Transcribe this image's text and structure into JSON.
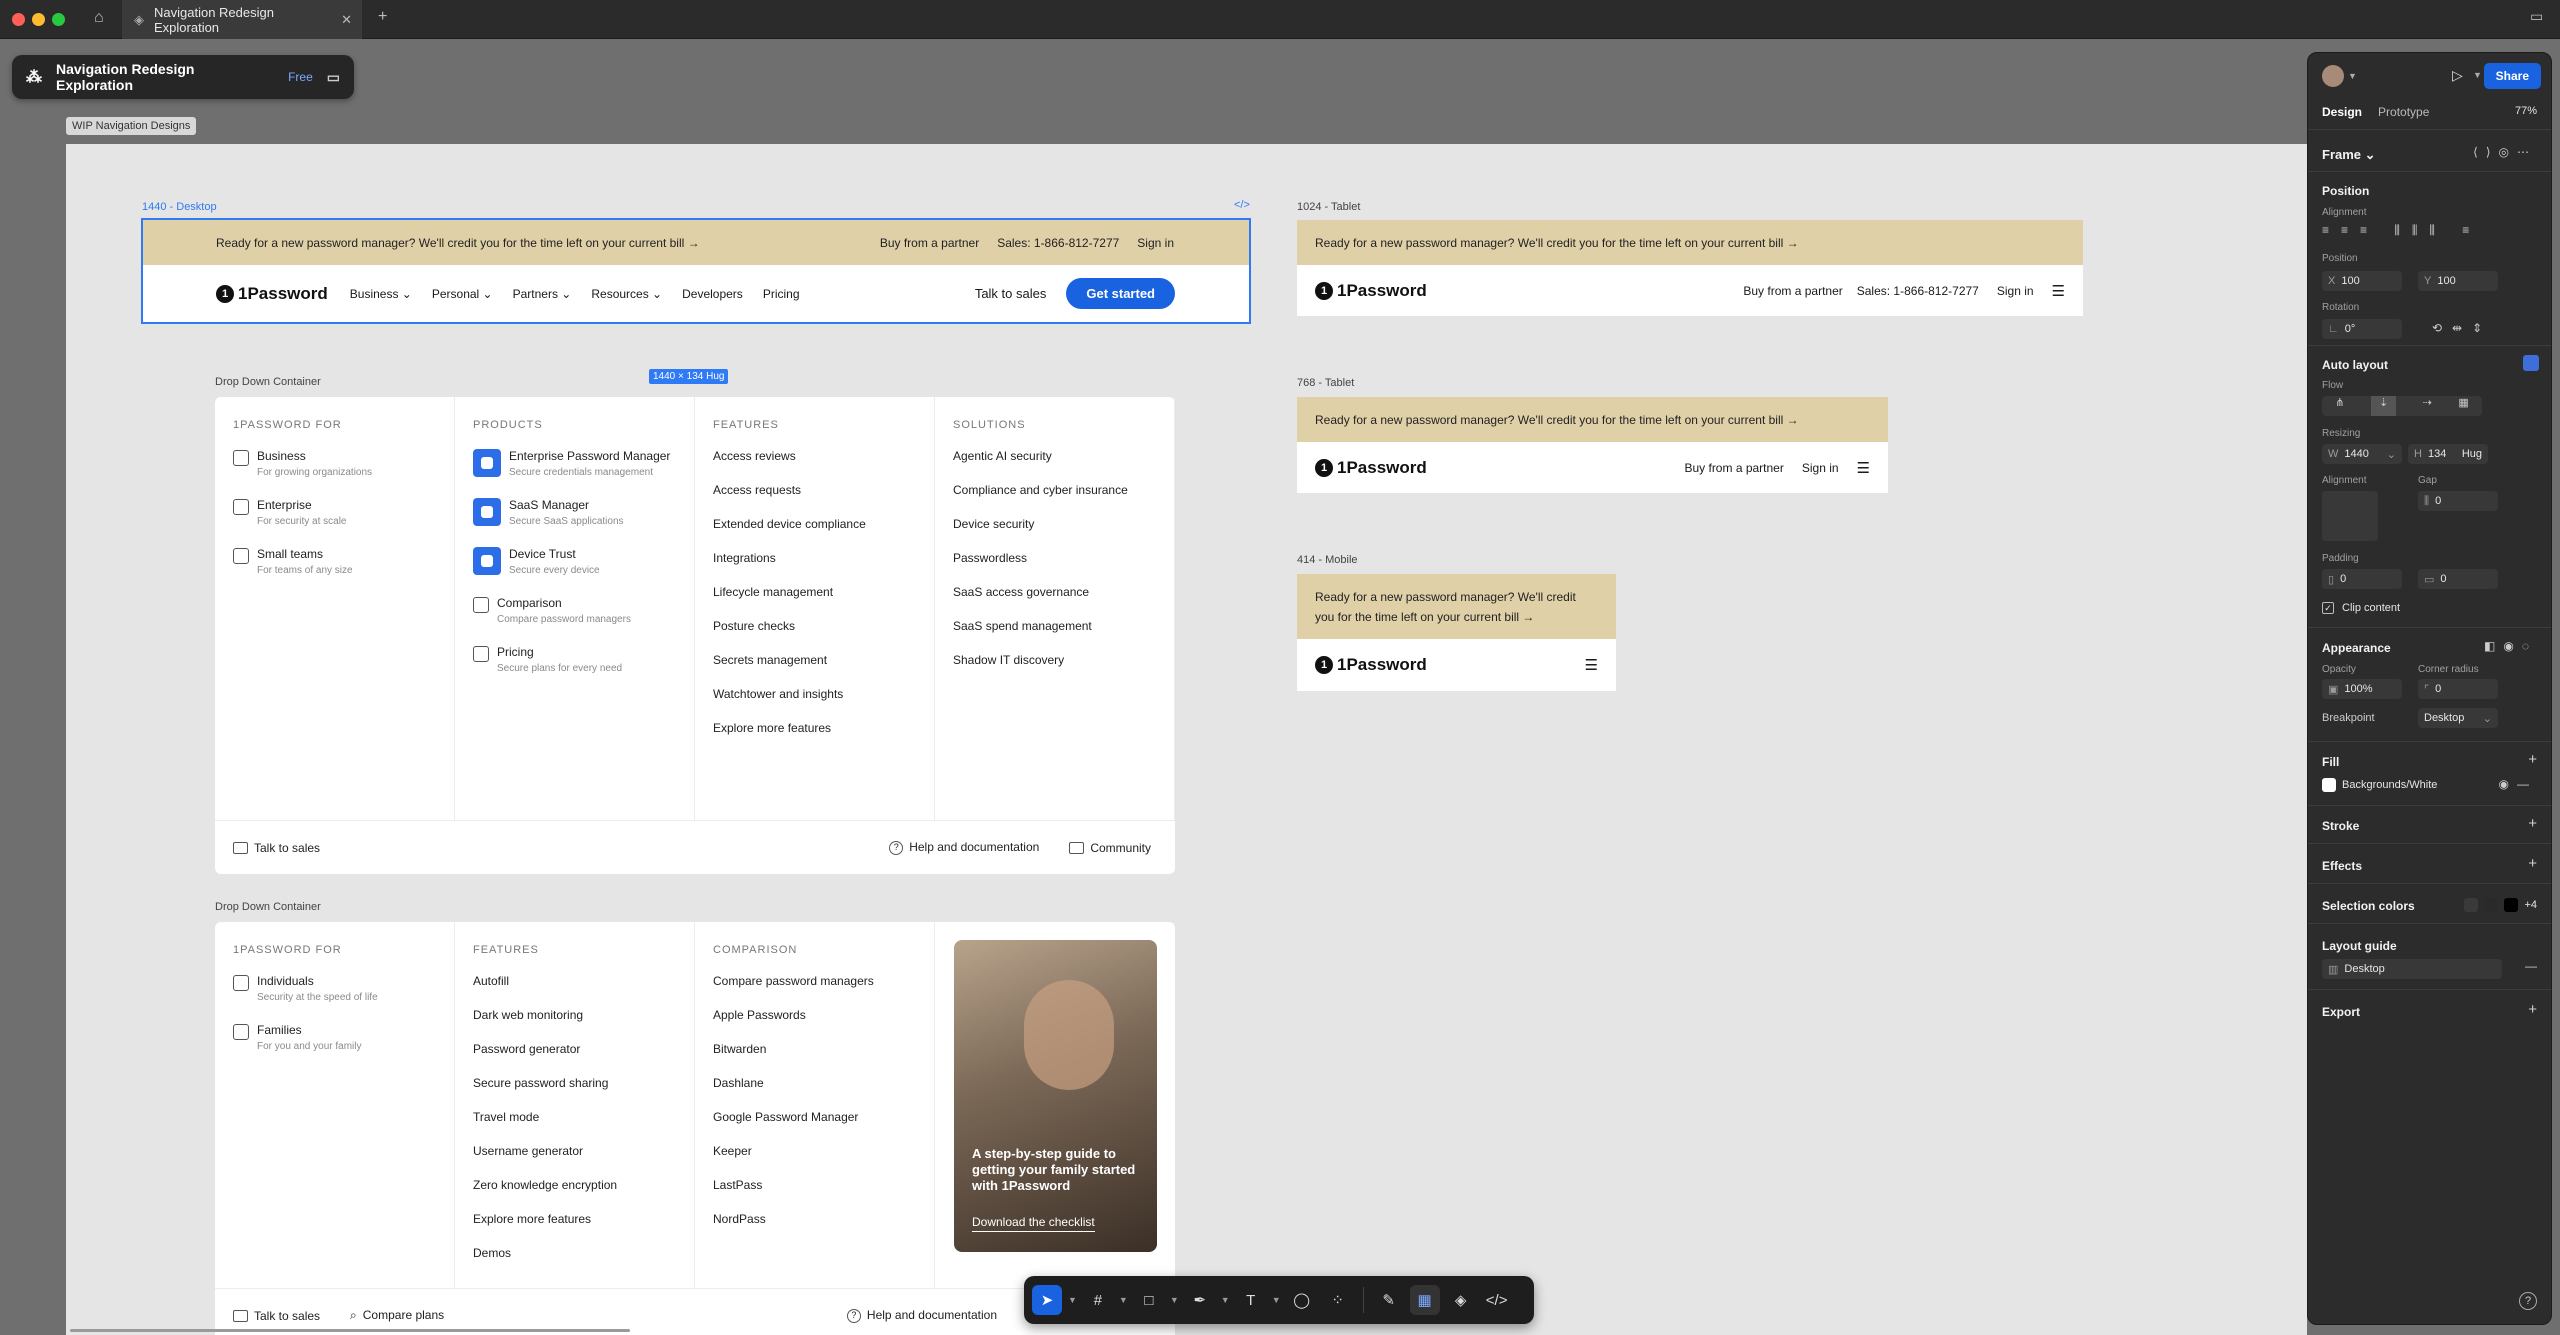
{
  "window": {
    "tab_title": "Navigation Redesign Exploration"
  },
  "file": {
    "name": "Navigation Redesign Exploration",
    "plan_badge": "Free"
  },
  "page_label": "WIP Navigation Designs",
  "frames": {
    "desktop": {
      "label": "1440 - Desktop",
      "size_badge": "1440 × 134 Hug"
    },
    "tablet1024": {
      "label": "1024 - Tablet"
    },
    "tablet768": {
      "label": "768 - Tablet"
    },
    "mobile": {
      "label": "414 - Mobile"
    }
  },
  "banner": {
    "text": "Ready for a new password manager? We'll credit you for the time left on your current bill →",
    "mobile_line1": "Ready for a new password manager? We'll credit",
    "mobile_line2": "you for the time left on your current bill →",
    "buy": "Buy from a partner",
    "sales": "Sales: 1-866-812-7277",
    "signin": "Sign in"
  },
  "nav": {
    "logo": "1Password",
    "items": [
      "Business ⌄",
      "Personal ⌄",
      "Partners ⌄",
      "Resources ⌄",
      "Developers",
      "Pricing"
    ],
    "talk": "Talk to sales",
    "cta": "Get started"
  },
  "dropdown1": {
    "label": "Drop Down Container",
    "col1": {
      "head": "1PASSWORD FOR",
      "items": [
        {
          "title": "Business",
          "sub": "For growing organizations"
        },
        {
          "title": "Enterprise",
          "sub": "For security at scale"
        },
        {
          "title": "Small teams",
          "sub": "For teams of any size"
        }
      ]
    },
    "col2": {
      "head": "PRODUCTS",
      "items": [
        {
          "title": "Enterprise Password Manager",
          "sub": "Secure credentials management"
        },
        {
          "title": "SaaS Manager",
          "sub": "Secure SaaS applications"
        },
        {
          "title": "Device Trust",
          "sub": "Secure every device"
        },
        {
          "title": "Comparison",
          "sub": "Compare password managers"
        },
        {
          "title": "Pricing",
          "sub": "Secure plans for every need"
        }
      ]
    },
    "col3": {
      "head": "FEATURES",
      "links": [
        "Access reviews",
        "Access requests",
        "Extended device compliance",
        "Integrations",
        "Lifecycle management",
        "Posture checks",
        "Secrets management",
        "Watchtower and insights",
        "Explore more features"
      ]
    },
    "col4": {
      "head": "SOLUTIONS",
      "links": [
        "Agentic AI security",
        "Compliance and cyber insurance",
        "Device security",
        "Passwordless",
        "SaaS access governance",
        "SaaS spend management",
        "Shadow IT discovery"
      ]
    },
    "footer": {
      "talk": "Talk to sales",
      "help": "Help and documentation",
      "community": "Community"
    }
  },
  "dropdown2": {
    "label": "Drop Down Container",
    "col1": {
      "head": "1PASSWORD FOR",
      "items": [
        {
          "title": "Individuals",
          "sub": "Security at the speed of life"
        },
        {
          "title": "Families",
          "sub": "For you and your family"
        }
      ]
    },
    "col2": {
      "head": "FEATURES",
      "links": [
        "Autofill",
        "Dark web monitoring",
        "Password generator",
        "Secure password sharing",
        "Travel mode",
        "Username generator",
        "Zero knowledge encryption",
        "Explore more features",
        "Demos"
      ]
    },
    "col3": {
      "head": "COMPARISON",
      "links": [
        "Compare password managers",
        "Apple Passwords",
        "Bitwarden",
        "Dashlane",
        "Google Password Manager",
        "Keeper",
        "LastPass",
        "NordPass"
      ]
    },
    "promo": {
      "text": "A step-by-step guide to getting your family started with 1Password",
      "link": "Download the checklist"
    },
    "footer": {
      "talk": "Talk to sales",
      "compare": "Compare plans",
      "help": "Help and documentation"
    }
  },
  "panel": {
    "share": "Share",
    "zoom": "77%",
    "tabs": [
      "Design",
      "Prototype"
    ],
    "frame": "Frame ⌄",
    "position": "Position",
    "alignment": "Alignment",
    "pos_label": "Position",
    "x": "100",
    "y": "100",
    "rotation_label": "Rotation",
    "rotation": "0°",
    "auto_layout": "Auto layout",
    "flow": "Flow",
    "resizing": "Resizing",
    "w": "1440",
    "h": "134",
    "hug": "Hug",
    "al_alignment": "Alignment",
    "gap_label": "Gap",
    "gap": "0",
    "padding_label": "Padding",
    "pad_h": "0",
    "pad_v": "0",
    "clip": "Clip content",
    "appearance": "Appearance",
    "opacity_label": "Opacity",
    "opacity": "100%",
    "radius_label": "Corner radius",
    "radius": "0",
    "breakpoint_label": "Breakpoint",
    "breakpoint": "Desktop",
    "fill": "Fill",
    "fill_value": "Backgrounds/White",
    "stroke": "Stroke",
    "effects": "Effects",
    "selection_colors": "Selection colors",
    "sel_more": "+4",
    "layout_guide": "Layout guide",
    "layout_guide_value": "Desktop",
    "export": "Export"
  },
  "colors": {
    "accent": "#1a63e0",
    "banner": "#dfd0a8"
  }
}
